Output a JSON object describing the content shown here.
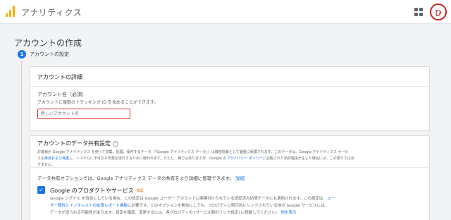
{
  "app": {
    "title": "アナリティクス",
    "avatar": "ひ"
  },
  "page": {
    "title": "アカウントの作成"
  },
  "step": {
    "number": "1",
    "label": "アカウントの設定"
  },
  "account_details": {
    "title": "アカウントの詳細",
    "name_label": "アカウント名（必須）",
    "name_help": "アカウントに複数のトラッキング ID を含めることができます。",
    "name_placeholder": "新しいアカウント名",
    "name_value": ""
  },
  "data_sharing": {
    "title": "アカウントのデータ共有設定",
    "help": "?",
    "desc_1": "お客様が Google アナリティクス を使って収集、処理、保存するデータ（「Google アナリティクス データ」）は機密情報として厳重に保護されます。このデータは、Google アナリティクス サービ",
    "desc_2a": "スを",
    "desc_2_link1": "維持および保護",
    "desc_2b": "し、システムに不可欠な作業を遂行するために使われます。ただし、稀ではありますが、Google の",
    "desc_2_link2": "プライバシー ポリシー",
    "desc_2c": "に記載された法的理由が生じた場合には、この限りではあ",
    "desc_3": "りません。",
    "options_text": "データ共有オプションでは、Google アナリティクス データの共有をより詳細に管理できます。",
    "options_link": "詳細",
    "option1": {
      "checked": true,
      "title": "Google のプロダクトやサービス",
      "badge": "推奨",
      "desc_1a": "Google シグナル を有効にしている場合、この設定は Google ユーザー アカウントに関連付けられている認証済み訪問データにも適用されます。この設定は、",
      "desc_1_link": "ユー",
      "desc_2_link": "ザー属性とインタレストの拡張レポート機能",
      "desc_2b": "に必要です。このオプションを無効にしても、プロパティに明示的にリンクされている他の Google サービスには、",
      "desc_3a": "データが送られる可能性があります。設定を確認、変更するには、各プロパティの [サービス間のリンク設定] に移動してください。",
      "desc_3_link": "例を表示"
    }
  },
  "colors": {
    "accent": "#1a73e8",
    "logo": "#f9ab00",
    "error_border": "#d93025"
  }
}
